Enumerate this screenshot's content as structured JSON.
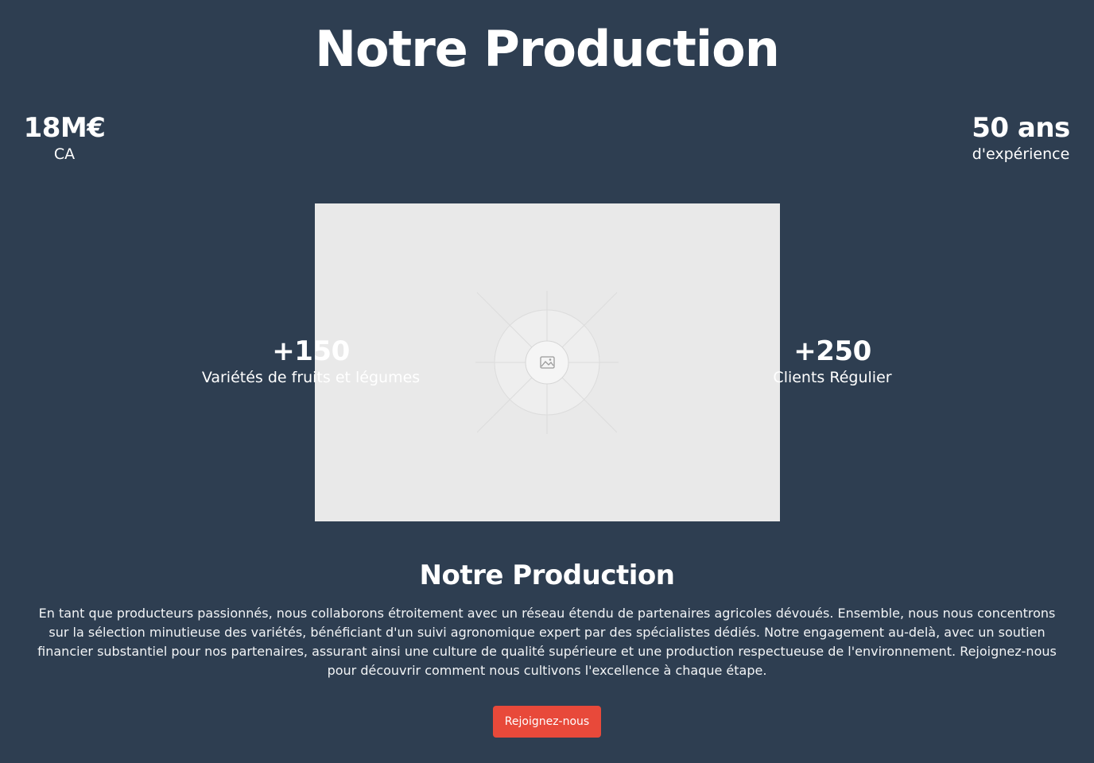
{
  "header": {
    "title": "Notre Production"
  },
  "stats": {
    "revenue": {
      "value": "18M€",
      "label": "CA"
    },
    "experience": {
      "value": "50 ans",
      "label": "d'expérience"
    },
    "varieties": {
      "value": "+150",
      "label": "Variétés de fruits et légumes"
    },
    "clients": {
      "value": "+250",
      "label": "Clients Régulier"
    }
  },
  "media": {
    "icon": "image-icon",
    "background_color": "#e9e9e9"
  },
  "section": {
    "title": "Notre Production",
    "description": "En tant que producteurs passionnés, nous collaborons étroitement avec un réseau étendu de partenaires agricoles dévoués. Ensemble, nous nous concentrons sur la sélection minutieuse des variétés, bénéficiant d'un suivi agronomique expert par des spécialistes dédiés. Notre engagement au-delà, avec un soutien financier substantiel pour nos partenaires, assurant ainsi une culture de qualité supérieure et une production respectueuse de l'environnement. Rejoignez-nous pour découvrir comment nous cultivons l'excellence à chaque étape.",
    "cta_label": "Rejoignez-nous"
  },
  "colors": {
    "background": "#2e3e51",
    "accent": "#e8493a",
    "text": "#ffffff"
  }
}
